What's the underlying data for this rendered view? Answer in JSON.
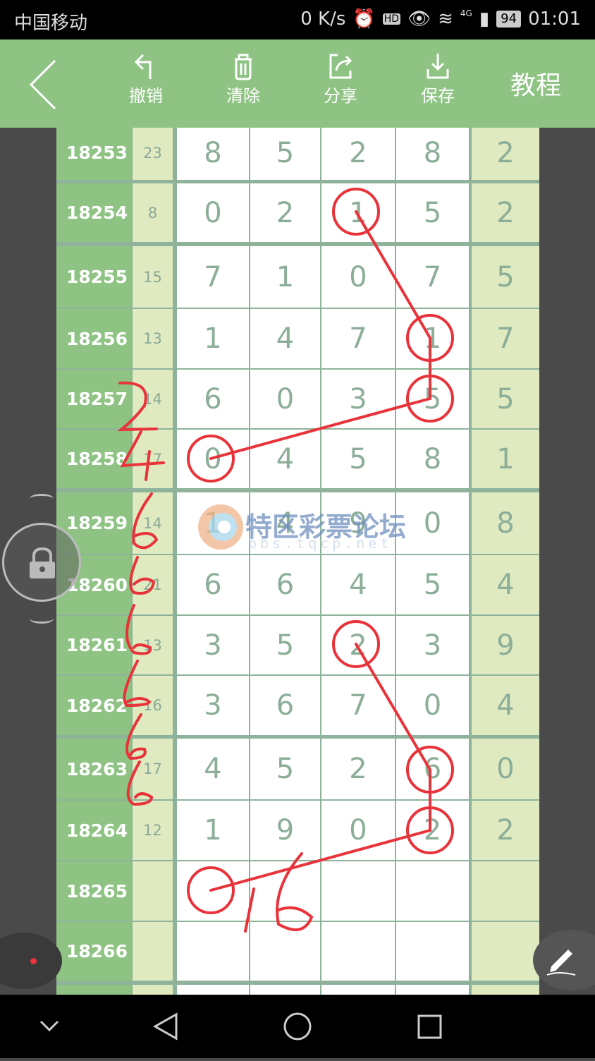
{
  "status_bar": {
    "carrier": "中国移动",
    "speed": "0 K/s",
    "network": "4G",
    "battery": "94",
    "time": "01:01"
  },
  "toolbar": {
    "undo": "撤销",
    "clear": "清除",
    "share": "分享",
    "save": "保存",
    "tutorial": "教程"
  },
  "watermark": {
    "text": "特区彩票论坛",
    "url": "bbs.tqcp.net"
  },
  "rows": [
    {
      "issue": "18253",
      "sum": "23",
      "digits": [
        "8",
        "5",
        "2",
        "8"
      ],
      "last": "2"
    },
    {
      "issue": "18254",
      "sum": "8",
      "digits": [
        "0",
        "2",
        "1",
        "5"
      ],
      "last": "2"
    },
    {
      "issue": "18255",
      "sum": "15",
      "digits": [
        "7",
        "1",
        "0",
        "7"
      ],
      "last": "5"
    },
    {
      "issue": "18256",
      "sum": "13",
      "digits": [
        "1",
        "4",
        "7",
        "1"
      ],
      "last": "7"
    },
    {
      "issue": "18257",
      "sum": "14",
      "digits": [
        "6",
        "0",
        "3",
        "5"
      ],
      "last": "5"
    },
    {
      "issue": "18258",
      "sum": "17",
      "digits": [
        "0",
        "4",
        "5",
        "8"
      ],
      "last": "1"
    },
    {
      "issue": "18259",
      "sum": "14",
      "digits": [
        "1",
        "4",
        "9",
        "0"
      ],
      "last": "8"
    },
    {
      "issue": "18260",
      "sum": "21",
      "digits": [
        "6",
        "6",
        "4",
        "5"
      ],
      "last": "4"
    },
    {
      "issue": "18261",
      "sum": "13",
      "digits": [
        "3",
        "5",
        "2",
        "3"
      ],
      "last": "9"
    },
    {
      "issue": "18262",
      "sum": "16",
      "digits": [
        "3",
        "6",
        "7",
        "0"
      ],
      "last": "4"
    },
    {
      "issue": "18263",
      "sum": "17",
      "digits": [
        "4",
        "5",
        "2",
        "6"
      ],
      "last": "0"
    },
    {
      "issue": "18264",
      "sum": "12",
      "digits": [
        "1",
        "9",
        "0",
        "2"
      ],
      "last": "2"
    },
    {
      "issue": "18265",
      "sum": "",
      "digits": [
        "",
        "",
        "",
        ""
      ],
      "last": ""
    },
    {
      "issue": "18266",
      "sum": "",
      "digits": [
        "",
        "",
        "",
        ""
      ],
      "last": ""
    }
  ],
  "colors": {
    "header": "#8ec383",
    "annotation": "#e8333a",
    "sum_bg": "#dfeac0"
  }
}
